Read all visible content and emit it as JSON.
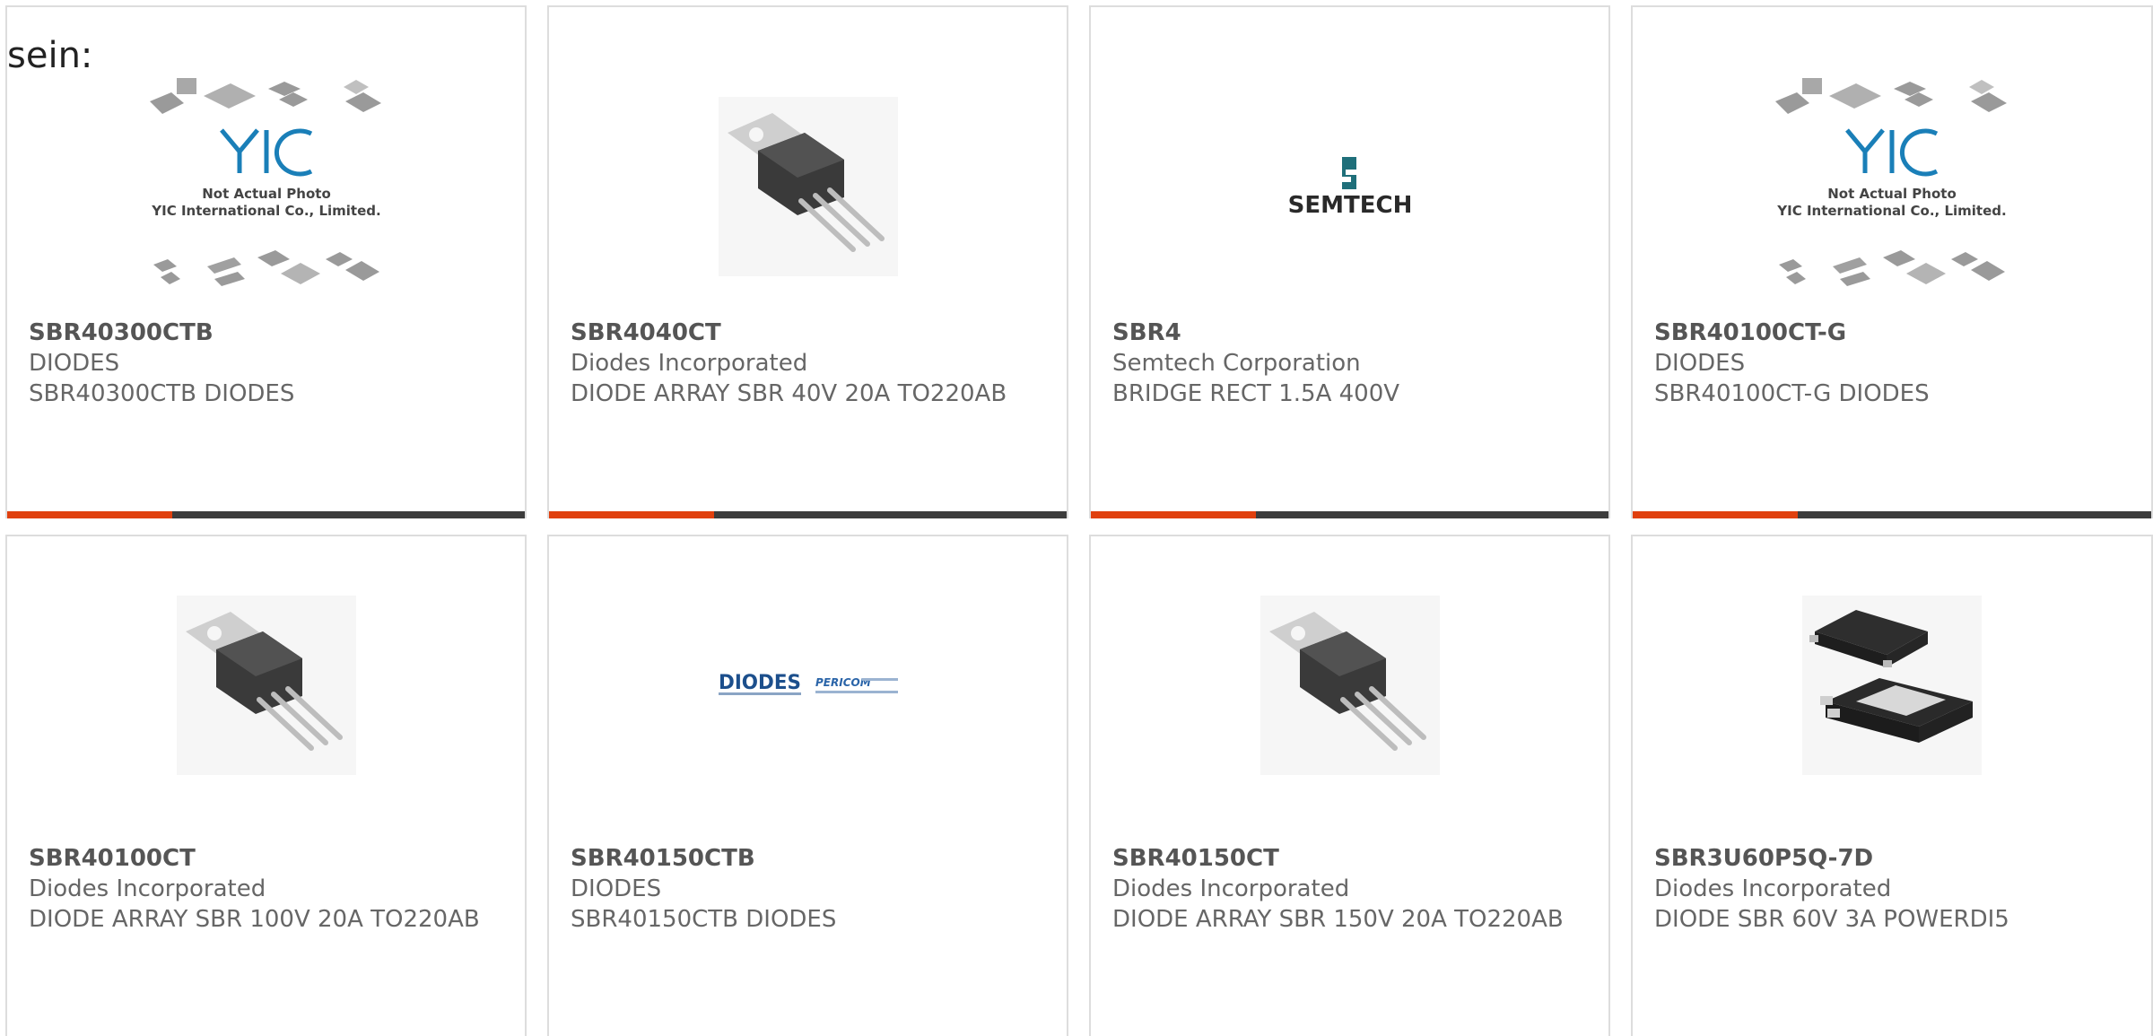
{
  "intro_text": "sein:",
  "accent_color": "#e0400e",
  "bar_color": "#3c3c3c",
  "products": [
    {
      "part": "SBR40300CTB",
      "manufacturer": "DIODES",
      "description": "SBR40300CTB DIODES",
      "image": "yic-placeholder",
      "image_text_1": "Not Actual Photo",
      "image_text_2": "YIC International Co., Limited."
    },
    {
      "part": "SBR4040CT",
      "manufacturer": "Diodes Incorporated",
      "description": "DIODE ARRAY SBR 40V 20A TO220AB",
      "image": "to220-package"
    },
    {
      "part": "SBR4",
      "manufacturer": "Semtech Corporation",
      "description": "BRIDGE RECT 1.5A 400V",
      "image": "semtech-logo",
      "image_text_1": "SEMTECH"
    },
    {
      "part": "SBR40100CT-G",
      "manufacturer": "DIODES",
      "description": "SBR40100CT-G DIODES",
      "image": "yic-placeholder",
      "image_text_1": "Not Actual Photo",
      "image_text_2": "YIC International Co., Limited."
    },
    {
      "part": "SBR40100CT",
      "manufacturer": "Diodes Incorporated",
      "description": "DIODE ARRAY SBR 100V 20A TO220AB",
      "image": "to220-package"
    },
    {
      "part": "SBR40150CTB",
      "manufacturer": "DIODES",
      "description": "SBR40150CTB DIODES",
      "image": "diodes-pericom-logo",
      "image_text_1": "DIODES",
      "image_text_2": "PERICOM"
    },
    {
      "part": "SBR40150CT",
      "manufacturer": "Diodes Incorporated",
      "description": "DIODE ARRAY SBR 150V 20A TO220AB",
      "image": "to220-package"
    },
    {
      "part": "SBR3U60P5Q-7D",
      "manufacturer": "Diodes Incorporated",
      "description": "DIODE SBR 60V 3A POWERDI5",
      "image": "powerdi5-package"
    }
  ]
}
